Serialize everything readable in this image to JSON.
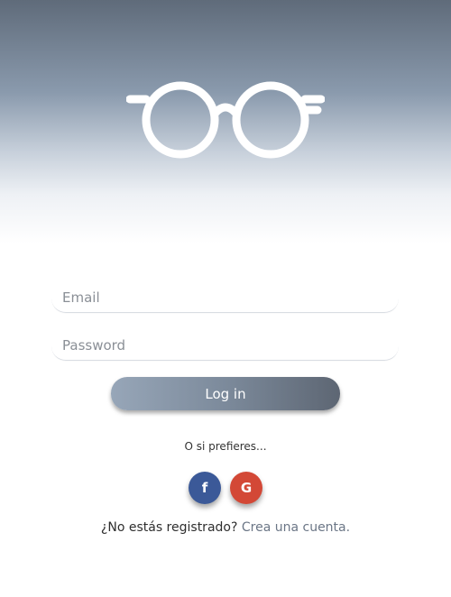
{
  "logo": {
    "icon": "glasses-icon",
    "color": "#ffffff"
  },
  "form": {
    "email_placeholder": "Email",
    "password_placeholder": "Password",
    "login_label": "Log in"
  },
  "alternatives": {
    "label": "O si prefieres...",
    "facebook": {
      "icon": "facebook-icon",
      "glyph": "f",
      "color": "#3b5998"
    },
    "google": {
      "icon": "google-icon",
      "glyph": "G",
      "color": "#d34836"
    }
  },
  "signup": {
    "prompt": "¿No estás registrado?",
    "link": "Crea una cuenta."
  },
  "colors": {
    "header_top": "#5f6b7a",
    "button_start": "#97a6b8",
    "button_end": "#5d6673"
  }
}
